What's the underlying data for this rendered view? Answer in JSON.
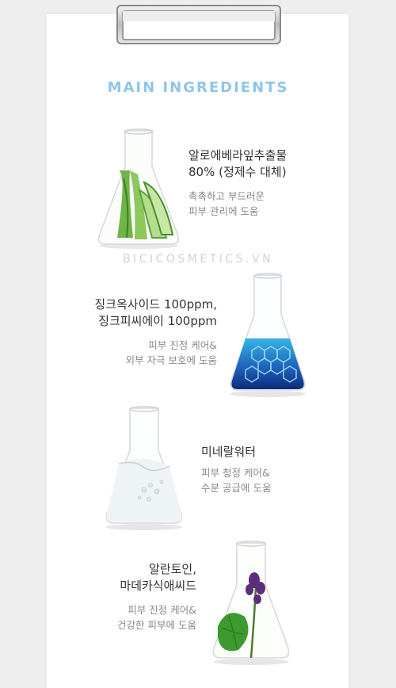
{
  "heading": "MAIN INGREDIENTS",
  "watermark": "BICICOSMETICS.VN",
  "ingredients": [
    {
      "name": [
        "알로에베라잎추출물",
        "80% (정제수 대체)"
      ],
      "desc": [
        "촉촉하고 부드러운",
        "피부 관리에 도움"
      ],
      "flask_content": "aloe-slices"
    },
    {
      "name": [
        "징크옥사이드 100ppm,",
        "징크피씨에이 100ppm"
      ],
      "desc": [
        "피부 진정 케어&",
        "외부 자극 보호에 도움"
      ],
      "flask_content": "blue-molecule-liquid"
    },
    {
      "name": [
        "미네랄워터"
      ],
      "desc": [
        "피부 청정 케어&",
        "수분 공급에 도움"
      ],
      "flask_content": "clear-water"
    },
    {
      "name": [
        "알란토인,",
        "마데카식애씨드"
      ],
      "desc": [
        "피부 진정 케어&",
        "건강한 피부에 도움"
      ],
      "flask_content": "green-leaf-purple-flower"
    }
  ],
  "colors": {
    "heading": "#8fc5ea",
    "name_text": "#333333",
    "desc_text": "#888888",
    "background": "#eeeeef",
    "paper": "#ffffff"
  }
}
